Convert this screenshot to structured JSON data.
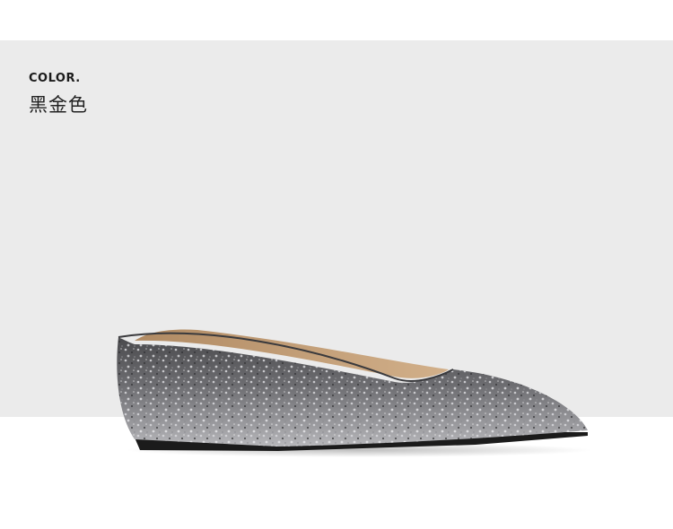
{
  "header": {
    "label": "COLOR.",
    "value": "黑金色"
  },
  "product": {
    "icon": "glitter-pointed-flat-shoe-icon"
  }
}
